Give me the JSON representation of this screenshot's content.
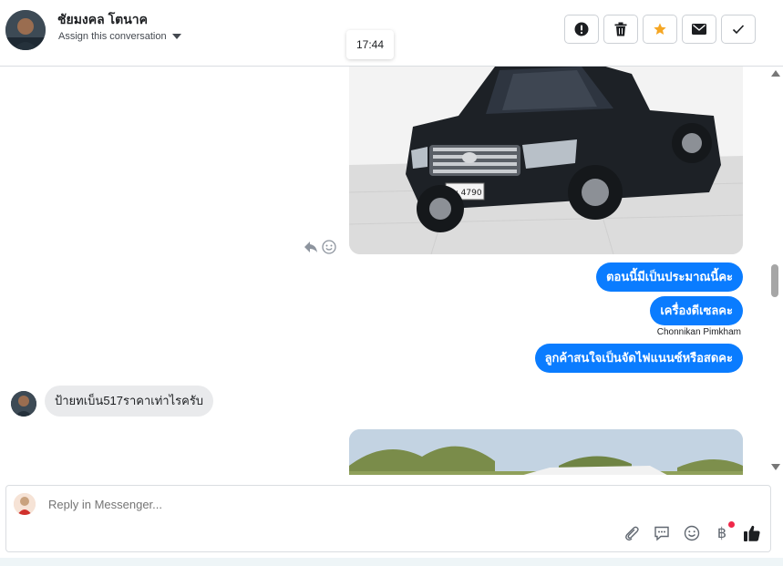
{
  "header": {
    "contact_name": "ชัยมงคล โตนาค",
    "assign_label": "Assign this conversation",
    "timestamp": "17:44",
    "actions": [
      {
        "name": "report-button",
        "icon": "exclamation-icon"
      },
      {
        "name": "delete-button",
        "icon": "trash-icon"
      },
      {
        "name": "star-button",
        "icon": "star-icon",
        "color": "#f5a623"
      },
      {
        "name": "mark-unread-button",
        "icon": "envelope-icon"
      },
      {
        "name": "mark-done-button",
        "icon": "check-icon"
      }
    ]
  },
  "messages": {
    "outgoing": [
      "ตอนนี้มีเป็นประมาณนี้คะ",
      "เครื่องดีเซลคะ",
      "ลูกค้าสนใจเป็นจัดไฟแนนซ์หรือสดคะ"
    ],
    "sender_name": "Chonnikan Pimkham",
    "incoming": "ป้ายทเบ็น517ราคาเท่าไรครับ",
    "car_plate": "ผน 4790",
    "accent_color": "#0a7cff"
  },
  "composer": {
    "placeholder": "Reply in Messenger...",
    "tools": [
      "paperclip-icon",
      "saved-reply-icon",
      "emoji-icon",
      "baht-payment-icon",
      "thumbs-up-icon"
    ],
    "baht_symbol": "฿"
  }
}
